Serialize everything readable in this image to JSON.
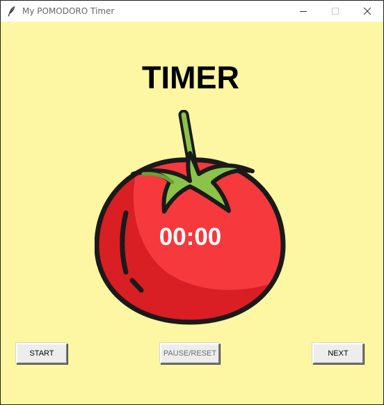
{
  "window": {
    "title": "My POMODORO Timer",
    "icon": "feather-icon",
    "controls": [
      "minimize-icon",
      "maximize-icon",
      "close-icon"
    ]
  },
  "main": {
    "heading": "TIMER",
    "timer_display": "00:00",
    "image": "tomato-icon"
  },
  "buttons": {
    "start": "START",
    "pause_reset": "PAUSE/RESET",
    "next": "NEXT"
  },
  "colors": {
    "background": "#fdf6a3",
    "heading": "#000000",
    "timer_text": "#ffffff",
    "tomato_red": "#f5393d",
    "tomato_shadow": "#d91e24",
    "leaf_green": "#8bc34a"
  }
}
